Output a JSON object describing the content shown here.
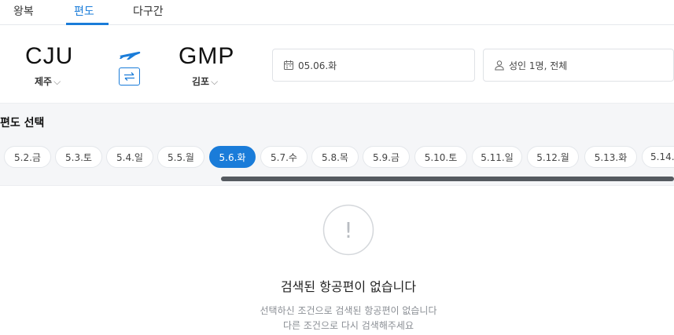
{
  "tabs": [
    {
      "label": "왕복"
    },
    {
      "label": "편도"
    },
    {
      "label": "다구간"
    }
  ],
  "route": {
    "origin": {
      "code": "CJU",
      "name": "제주"
    },
    "destination": {
      "code": "GMP",
      "name": "김포"
    },
    "chevron": "⌵"
  },
  "date_field": {
    "value": "05.06.화"
  },
  "passenger_field": {
    "value": "성인 1명, 전체"
  },
  "section_title": "편도 선택",
  "dates": [
    {
      "label": "5.2.금"
    },
    {
      "label": "5.3.토"
    },
    {
      "label": "5.4.일"
    },
    {
      "label": "5.5.월"
    },
    {
      "label": "5.6.화"
    },
    {
      "label": "5.7.수"
    },
    {
      "label": "5.8.목"
    },
    {
      "label": "5.9.금"
    },
    {
      "label": "5.10.토"
    },
    {
      "label": "5.11.일"
    },
    {
      "label": "5.12.월"
    },
    {
      "label": "5.13.화"
    },
    {
      "label": "5.14."
    }
  ],
  "selected_date_index": 4,
  "empty_state": {
    "icon_glyph": "!",
    "title": "검색된 항공편이 없습니다",
    "line1": "선택하신 조건으로 검색된 항공편이 없습니다",
    "line2": "다른 조건으로 다시 검색해주세요"
  },
  "colors": {
    "accent": "#1a7cd9",
    "scrollbar": "#555a60",
    "band": "#f5f6f8"
  },
  "icons": [
    "airplane-icon",
    "swap-icon",
    "calendar-icon",
    "person-icon",
    "alert-circle-icon"
  ]
}
